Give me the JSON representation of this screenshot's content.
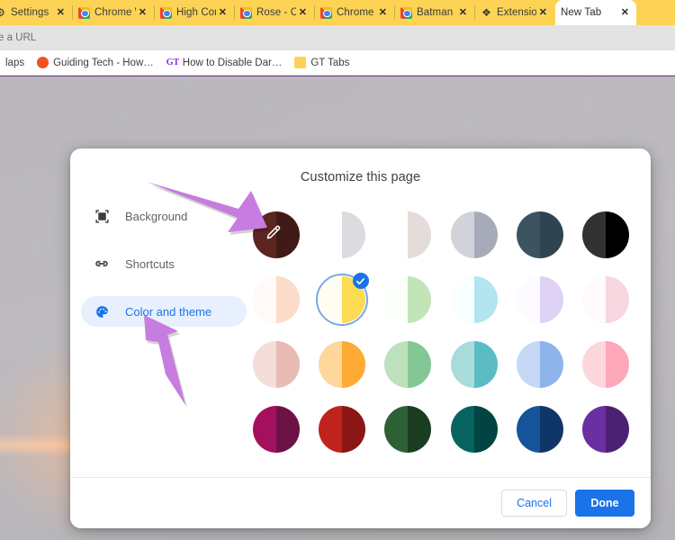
{
  "browser": {
    "tabs": [
      {
        "title": "Settings",
        "favicon": "gear-icon",
        "active": false
      },
      {
        "title": "Chrome W",
        "favicon": "chrome-icon",
        "active": false
      },
      {
        "title": "High Cont",
        "favicon": "chrome-icon",
        "active": false
      },
      {
        "title": "Rose - Chr",
        "favicon": "chrome-icon",
        "active": false
      },
      {
        "title": "Chrome W",
        "favicon": "chrome-icon",
        "active": false
      },
      {
        "title": "Batman M",
        "favicon": "chrome-icon",
        "active": false
      },
      {
        "title": "Extension",
        "favicon": "puzzle-icon",
        "active": false
      },
      {
        "title": "New Tab",
        "favicon": "none",
        "active": true
      }
    ],
    "tab_close_label": "✕",
    "omnibox": {
      "text": "e a URL"
    },
    "bookmarks": [
      {
        "label": "laps",
        "icon": "folder-icon"
      },
      {
        "label": "Guiding Tech - How…",
        "icon": "orange-dot-icon"
      },
      {
        "label": "How to Disable Dar…",
        "icon": "gt-icon"
      },
      {
        "label": "GT Tabs",
        "icon": "folder-icon"
      }
    ],
    "tabstrip_color": "#fcd354",
    "window_border_color": "#6b3f8f"
  },
  "dialog": {
    "title": "Customize this page",
    "sidebar": [
      {
        "label": "Background",
        "icon": "image-icon",
        "selected": false
      },
      {
        "label": "Shortcuts",
        "icon": "link-icon",
        "selected": false
      },
      {
        "label": "Color and theme",
        "icon": "palette-icon",
        "selected": true
      }
    ],
    "swatches": [
      {
        "name": "custom-color-picker",
        "left": "#5c2620",
        "right": "#3f1a16",
        "eyedropper": true,
        "selected": false,
        "outlined": false
      },
      {
        "name": "grey-light",
        "left": "#ffffff",
        "right": "#dadce0",
        "eyedropper": false,
        "selected": false,
        "outlined": true
      },
      {
        "name": "warm-grey",
        "left": "#ffffff",
        "right": "#e4dcd8",
        "eyedropper": false,
        "selected": false,
        "outlined": true
      },
      {
        "name": "cool-grey",
        "left": "#d2d3da",
        "right": "#a7abb8",
        "eyedropper": false,
        "selected": false,
        "outlined": false
      },
      {
        "name": "slate-blue-dark",
        "left": "#3c5360",
        "right": "#2e4450",
        "eyedropper": false,
        "selected": false,
        "outlined": false
      },
      {
        "name": "black",
        "left": "#323232",
        "right": "#000000",
        "eyedropper": false,
        "selected": false,
        "outlined": false
      },
      {
        "name": "peach-light",
        "left": "#fffaf8",
        "right": "#fcdcc8",
        "eyedropper": false,
        "selected": false,
        "outlined": true
      },
      {
        "name": "yellow",
        "left": "#fffdf2",
        "right": "#fcdc52",
        "eyedropper": false,
        "selected": true,
        "outlined": false
      },
      {
        "name": "mint-light",
        "left": "#fbfff9",
        "right": "#c2e5b8",
        "eyedropper": false,
        "selected": false,
        "outlined": true
      },
      {
        "name": "cyan-light",
        "left": "#f8ffff",
        "right": "#b2e5f0",
        "eyedropper": false,
        "selected": false,
        "outlined": true
      },
      {
        "name": "lavender-light",
        "left": "#fdfbff",
        "right": "#ded2f5",
        "eyedropper": false,
        "selected": false,
        "outlined": true
      },
      {
        "name": "pink-light",
        "left": "#fffbfc",
        "right": "#f7d6e0",
        "eyedropper": false,
        "selected": false,
        "outlined": true
      },
      {
        "name": "rose-pale",
        "left": "#f6ded8",
        "right": "#e7bcb2",
        "eyedropper": false,
        "selected": false,
        "outlined": true
      },
      {
        "name": "orange",
        "left": "#ffd79b",
        "right": "#fdab35",
        "eyedropper": false,
        "selected": false,
        "outlined": false
      },
      {
        "name": "green-pale",
        "left": "#bde0bd",
        "right": "#83c894",
        "eyedropper": false,
        "selected": false,
        "outlined": false
      },
      {
        "name": "teal-pale",
        "left": "#a9dbdb",
        "right": "#5bbcc6",
        "eyedropper": false,
        "selected": false,
        "outlined": false
      },
      {
        "name": "blue-pale",
        "left": "#c5d8f5",
        "right": "#8fb4ec",
        "eyedropper": false,
        "selected": false,
        "outlined": false
      },
      {
        "name": "pink",
        "left": "#fdd5dd",
        "right": "#fca8b8",
        "eyedropper": false,
        "selected": false,
        "outlined": false
      },
      {
        "name": "magenta-dark",
        "left": "#a4105d",
        "right": "#6d1244",
        "eyedropper": false,
        "selected": false,
        "outlined": false
      },
      {
        "name": "red-dark",
        "left": "#c0231d",
        "right": "#8b1613",
        "eyedropper": false,
        "selected": false,
        "outlined": false
      },
      {
        "name": "green-dark",
        "left": "#2d6134",
        "right": "#1b3d22",
        "eyedropper": false,
        "selected": false,
        "outlined": false
      },
      {
        "name": "teal-dark",
        "left": "#06635f",
        "right": "#024441",
        "eyedropper": false,
        "selected": false,
        "outlined": false
      },
      {
        "name": "navy-blue",
        "left": "#15539b",
        "right": "#103667",
        "eyedropper": false,
        "selected": false,
        "outlined": false
      },
      {
        "name": "purple-dark",
        "left": "#6a2fa0",
        "right": "#4b2273",
        "eyedropper": false,
        "selected": false,
        "outlined": false
      }
    ],
    "footer": {
      "cancel_label": "Cancel",
      "done_label": "Done",
      "accent_color": "#1a73e8"
    }
  },
  "annotations": {
    "arrow_color": "#c77ce0",
    "arrow_1_points_to": "custom-color-picker-swatch",
    "arrow_2_points_to": "sidebar-item-color-and-theme"
  }
}
